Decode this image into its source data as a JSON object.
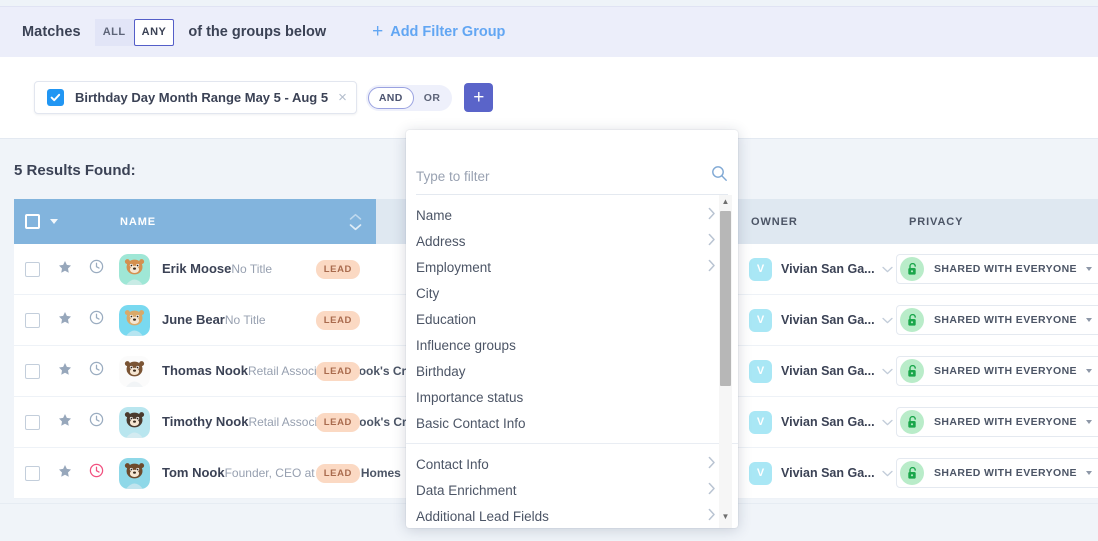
{
  "filter_header": {
    "matches_label": "Matches",
    "options": [
      {
        "label": "ALL",
        "active": false
      },
      {
        "label": "ANY",
        "active": true
      }
    ],
    "suffix_label": "of the groups below",
    "add_filter_group": "Add Filter Group"
  },
  "filter_row": {
    "chip_text": "Birthday Day Month Range May 5 - Aug 5",
    "chip_checked": true,
    "close_icon": "×",
    "and_label": "AND",
    "or_label": "OR",
    "and_active": true,
    "add_button": "+"
  },
  "results": {
    "title": "5 Results Found:",
    "columns": [
      "NAME",
      "OWNER",
      "PRIVACY"
    ],
    "rows": [
      {
        "name": "Erik Moose",
        "title_prefix": "No Title",
        "title_company": "",
        "badge": "LEAD",
        "owner_initial": "V",
        "owner": "Vivian San Ga...",
        "privacy": "SHARED WITH EVERYONE",
        "clock_alert": false,
        "avatar_bg": "#9fe7d6",
        "avatar_body": "#d4904f"
      },
      {
        "name": "June Bear",
        "title_prefix": "No Title",
        "title_company": "",
        "badge": "LEAD",
        "owner_initial": "V",
        "owner": "Vivian San Ga...",
        "privacy": "SHARED WITH EVERYONE",
        "clock_alert": false,
        "avatar_bg": "#79d9f0",
        "avatar_body": "#d9a96a"
      },
      {
        "name": "Thomas Nook",
        "title_prefix": "Retail Associate at ",
        "title_company": "Nook's Cra…",
        "badge": "LEAD",
        "owner_initial": "V",
        "owner": "Vivian San Ga...",
        "privacy": "SHARED WITH EVERYONE",
        "clock_alert": false,
        "avatar_bg": "#fbfbfb",
        "avatar_body": "#7a5434"
      },
      {
        "name": "Timothy Nook",
        "title_prefix": "Retail Associate at ",
        "title_company": "Nook's Cra…",
        "badge": "LEAD",
        "owner_initial": "V",
        "owner": "Vivian San Ga...",
        "privacy": "SHARED WITH EVERYONE",
        "clock_alert": false,
        "avatar_bg": "#b9e6ef",
        "avatar_body": "#4a3a2e"
      },
      {
        "name": "Tom Nook",
        "title_prefix": "Founder, CEO at ",
        "title_company": "Nook's Homes",
        "badge": "LEAD",
        "owner_initial": "V",
        "owner": "Vivian San Ga...",
        "privacy": "SHARED WITH EVERYONE",
        "clock_alert": true,
        "avatar_bg": "#8fd8e8",
        "avatar_body": "#6d4a2c"
      }
    ]
  },
  "dropdown": {
    "search_placeholder": "Type to filter",
    "search_value": "",
    "group_one": [
      {
        "label": "Name",
        "has_submenu": true
      },
      {
        "label": "Address",
        "has_submenu": true
      },
      {
        "label": "Employment",
        "has_submenu": true
      },
      {
        "label": "City",
        "has_submenu": false
      },
      {
        "label": "Education",
        "has_submenu": false
      },
      {
        "label": "Influence groups",
        "has_submenu": false
      },
      {
        "label": "Birthday",
        "has_submenu": false
      },
      {
        "label": "Importance status",
        "has_submenu": false
      },
      {
        "label": "Basic Contact Info",
        "has_submenu": false
      }
    ],
    "group_two": [
      {
        "label": "Contact Info",
        "has_submenu": true
      },
      {
        "label": "Data Enrichment",
        "has_submenu": true
      },
      {
        "label": "Additional Lead Fields",
        "has_submenu": true
      }
    ]
  },
  "colors": {
    "accent_blue": "#62a6f3",
    "indigo": "#5a64c9",
    "header_blue": "#82b4dd",
    "badge_bg": "#fbd9c3",
    "lock_green": "#b9ecc9",
    "alert_pink": "#f1507f"
  }
}
